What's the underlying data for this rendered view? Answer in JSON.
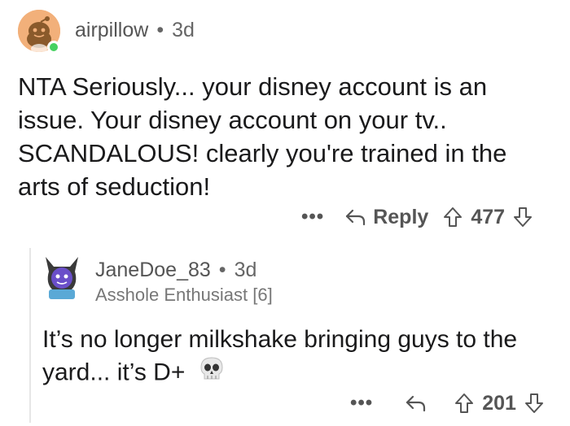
{
  "comment1": {
    "username": "airpillow",
    "separator": "•",
    "age": "3d",
    "text": "NTA Seriously... your disney account is an issue. Your disney account on your tv.. SCANDALOUS! clearly you're trained in the arts of seduction!",
    "more": "•••",
    "reply_label": "Reply",
    "score": "477",
    "avatar_icon": "reddit-avatar-icon",
    "online_color": "#46d160"
  },
  "comment2": {
    "username": "JaneDoe_83",
    "separator": "•",
    "age": "3d",
    "flair": "Asshole Enthusiast [6]",
    "text": "It’s no longer milkshake bringing guys to the yard... it’s D+",
    "emoji": "skull-icon",
    "more": "•••",
    "score": "201",
    "avatar_icon": "bat-avatar-icon"
  },
  "colors": {
    "text": "#1a1a1b",
    "meta": "#555555",
    "avatar_bg": "#f2b07a"
  }
}
